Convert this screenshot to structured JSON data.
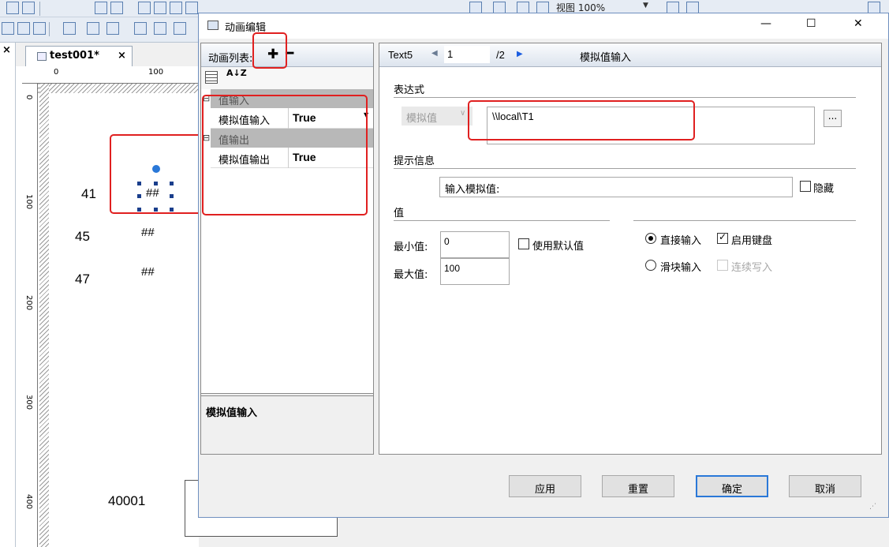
{
  "toolbar": {
    "zoom_label": "视图 100%",
    "zoom_arrow": "▼"
  },
  "document": {
    "tab_title": "test001*",
    "tab_close": "×",
    "side_close": "×"
  },
  "ruler": {
    "top_ticks": [
      "0",
      "100"
    ],
    "left_ticks": [
      "0",
      "100",
      "200",
      "300",
      "400"
    ]
  },
  "canvas": {
    "labels": [
      "41",
      "45",
      "47",
      "40001"
    ],
    "value_placeholders": [
      "##",
      "##",
      "##"
    ]
  },
  "dialog": {
    "title": "动画编辑",
    "minimize": "—",
    "maximize": "☐",
    "close": "✕",
    "animation_list": {
      "title": "动画列表:",
      "add": "✚",
      "remove": "━",
      "sort_icon": "A↓Z",
      "groups": [
        {
          "title": "值输入",
          "expander": "⊟",
          "rows": [
            {
              "name": "模拟值输入",
              "value": "True",
              "dropdown": "▼"
            }
          ]
        },
        {
          "title": "值输出",
          "expander": "⊟",
          "rows": [
            {
              "name": "模拟值输出",
              "value": "True"
            }
          ]
        }
      ],
      "description": "模拟值输入"
    },
    "detail": {
      "object_name": "Text5",
      "prev": "◀",
      "page": "1",
      "total": "/2",
      "next": "▶",
      "animation_type": "模拟值输入",
      "expression": {
        "section": "表达式",
        "source_combo": "模拟值",
        "source_arrow": "∨",
        "value": "\\\\local\\T1",
        "browse": "..."
      },
      "tip": {
        "section": "提示信息",
        "value": "输入模拟值:",
        "hide_label": "隐藏",
        "hide_checked": false
      },
      "value_section": {
        "section": "值",
        "min_label": "最小值:",
        "min_value": "0",
        "max_label": "最大值:",
        "max_value": "100",
        "use_default_label": "使用默认值",
        "use_default_checked": false,
        "direct_input_label": "直接输入",
        "direct_input_selected": true,
        "keyboard_label": "启用键盘",
        "keyboard_checked": true,
        "slider_input_label": "滑块输入",
        "slider_input_selected": false,
        "continuous_write_label": "连续写入",
        "continuous_write_checked": false
      }
    },
    "buttons": {
      "apply": "应用",
      "reset": "重置",
      "ok": "确定",
      "cancel": "取消"
    }
  },
  "colors": {
    "highlight_box": "#e02020",
    "accent_blue": "#2a78d8",
    "category_bg": "#b8b8b8"
  }
}
